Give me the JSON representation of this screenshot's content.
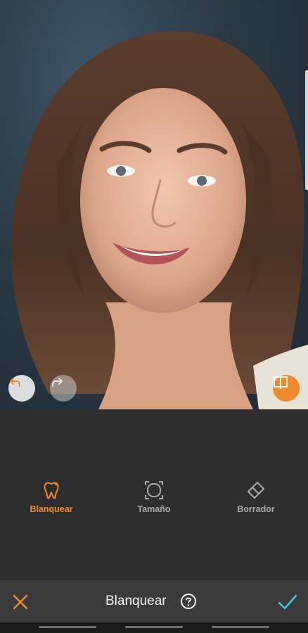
{
  "tools": [
    {
      "label": "Blanquear",
      "icon": "tooth-icon",
      "active": true
    },
    {
      "label": "Tamaño",
      "icon": "resize-icon",
      "active": false
    },
    {
      "label": "Borrador",
      "icon": "eraser-icon",
      "active": false
    }
  ],
  "action_bar": {
    "title": "Blanquear",
    "cancel_icon": "close-icon",
    "confirm_icon": "check-icon",
    "help_icon": "help-icon"
  },
  "photo_controls": {
    "undo_icon": "undo-icon",
    "redo_icon": "redo-icon",
    "compare_icon": "compare-icon"
  },
  "colors": {
    "accent": "#f08a2c",
    "confirm": "#3ec9e6",
    "tool_inactive": "#a9a9a9",
    "panel": "#2e2e2e"
  }
}
